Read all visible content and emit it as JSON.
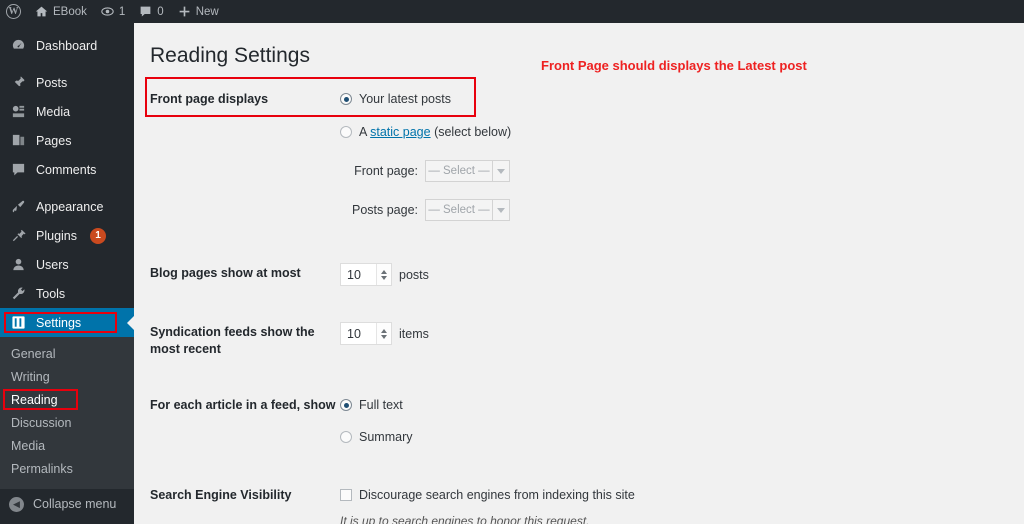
{
  "adminbar": {
    "logo_icon": "wordpress-logo-icon",
    "site_icon": "home-icon",
    "site_name": "EBook",
    "updates_icon": "updates-icon",
    "updates_count": "1",
    "comments_icon": "comment-bubble-icon",
    "comments_count": "0",
    "new_icon": "plus-icon",
    "new_label": "New"
  },
  "sidebar": {
    "items": [
      {
        "label": "Dashboard",
        "icon": "dashboard-icon",
        "current": false
      },
      {
        "label": "Posts",
        "icon": "pin-icon",
        "current": false
      },
      {
        "label": "Media",
        "icon": "media-icon",
        "current": false
      },
      {
        "label": "Pages",
        "icon": "pages-icon",
        "current": false
      },
      {
        "label": "Comments",
        "icon": "comment-bubble-icon",
        "current": false
      },
      {
        "label": "Appearance",
        "icon": "paintbrush-icon",
        "current": false
      },
      {
        "label": "Plugins",
        "icon": "plug-icon",
        "current": false,
        "badge": "1"
      },
      {
        "label": "Users",
        "icon": "user-icon",
        "current": false
      },
      {
        "label": "Tools",
        "icon": "wrench-icon",
        "current": false
      },
      {
        "label": "Settings",
        "icon": "settings-sliders-icon",
        "current": true
      }
    ],
    "submenu": [
      {
        "label": "General",
        "current": false
      },
      {
        "label": "Writing",
        "current": false
      },
      {
        "label": "Reading",
        "current": true
      },
      {
        "label": "Discussion",
        "current": false
      },
      {
        "label": "Media",
        "current": false
      },
      {
        "label": "Permalinks",
        "current": false
      }
    ],
    "collapse_label": "Collapse menu",
    "collapse_icon": "chevron-left-circle-icon",
    "current_color": "#0073aa",
    "badge_color": "#ca4a1f"
  },
  "main": {
    "page_title": "Reading Settings",
    "front_page_displays": {
      "label": "Front page displays",
      "option_latest": "Your latest posts",
      "option_static_prefix": "A ",
      "option_static_link": "static page",
      "option_static_suffix": " (select below)",
      "selected": "latest"
    },
    "front_page_select": {
      "label": "Front page:",
      "value": "— Select —"
    },
    "posts_page_select": {
      "label": "Posts page:",
      "value": "— Select —"
    },
    "blog_pages": {
      "label": "Blog pages show at most",
      "value": "10",
      "unit": "posts"
    },
    "syndication": {
      "label": "Syndication feeds show the most recent",
      "value": "10",
      "unit": "items"
    },
    "feed_show": {
      "label": "For each article in a feed, show",
      "option_full": "Full text",
      "option_summary": "Summary",
      "selected": "full"
    },
    "search_visibility": {
      "label": "Search Engine Visibility",
      "checkbox_label": "Discourage search engines from indexing this site",
      "checked": false,
      "hint": "It is up to search engines to honor this request."
    }
  },
  "annotations": {
    "note_text": "Front Page should displays the Latest post",
    "note_color": "#ee2222",
    "box_color": "#e8000d"
  }
}
